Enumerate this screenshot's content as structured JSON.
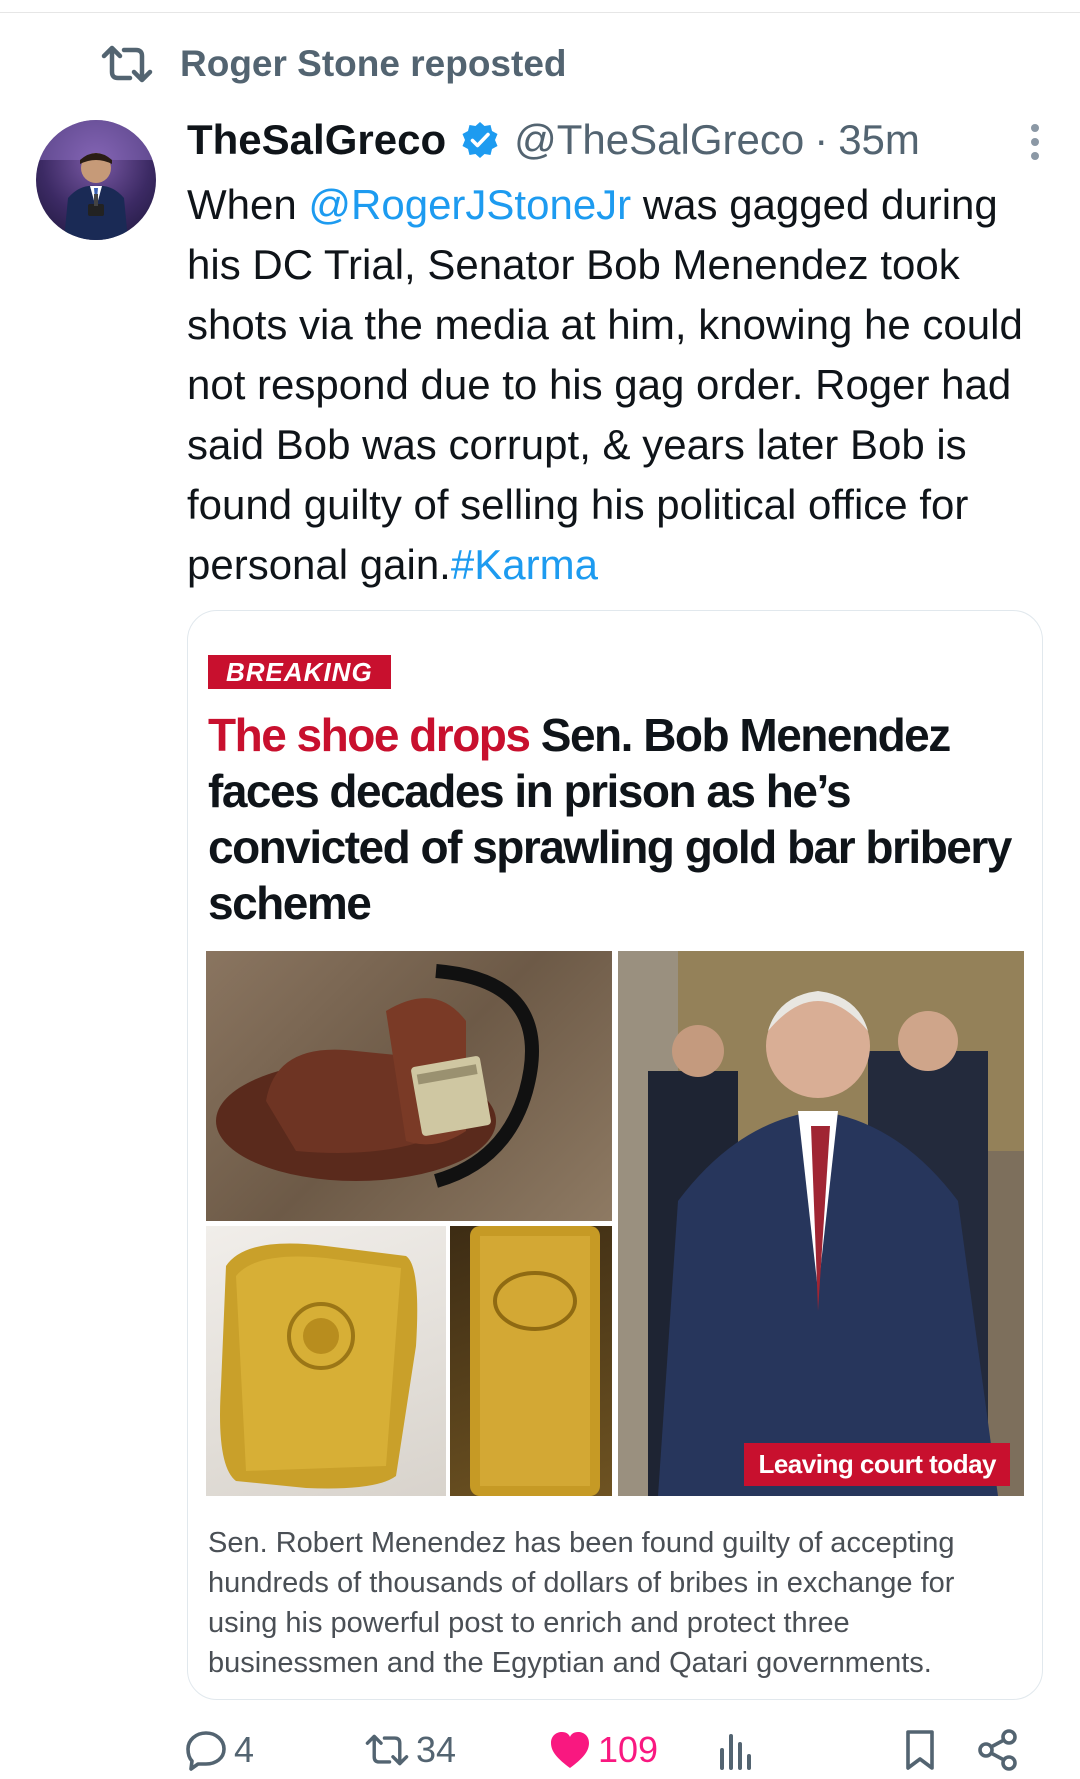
{
  "repost": {
    "text": "Roger Stone reposted"
  },
  "tweet": {
    "display_name": "TheSalGreco",
    "handle": "@TheSalGreco",
    "separator": "·",
    "time": "35m",
    "text_before_mention": "When ",
    "mention": "@RogerJStoneJr",
    "text_after_mention": " was gagged during his DC Trial, Senator Bob Menendez took shots via the media at him, knowing he could not respond due to his gag order. Roger had said Bob was corrupt, & years later Bob is found guilty of selling his political office for personal gain.",
    "hashtag": "#Karma"
  },
  "card": {
    "badge": "BREAKING",
    "headline_kicker": "The shoe drops",
    "headline_rest": " Sen. Bob Menendez faces decades in prison as he’s convicted of sprawling gold bar bribery scheme",
    "photo_caption": "Leaving court today",
    "summary": "Sen. Robert Menendez has been found guilty of accepting hundreds of thousands of dollars of bribes in exchange for using his powerful post to enrich and protect three businessmen and the Egyptian and Qatari governments."
  },
  "actions": {
    "replies": "4",
    "reposts": "34",
    "likes": "109"
  },
  "colors": {
    "accent": "#1d9bf0",
    "like": "#f91880",
    "breaking_red": "#c8102e",
    "muted": "#536471"
  },
  "icons": {
    "repost": "repost-icon",
    "verified": "verified-badge-icon",
    "more": "more-options-icon",
    "reply": "reply-icon",
    "like": "heart-icon",
    "views": "views-chart-icon",
    "bookmark": "bookmark-icon",
    "share": "share-icon"
  }
}
